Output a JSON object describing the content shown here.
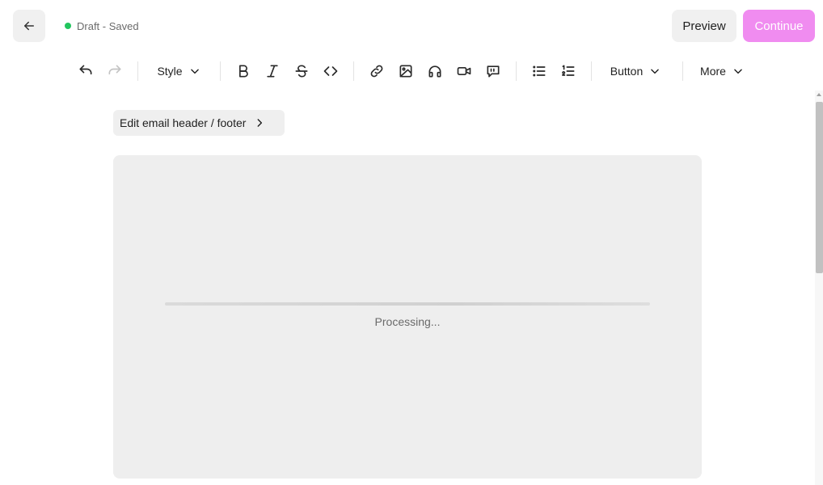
{
  "header": {
    "status_text": "Draft - Saved",
    "status_color": "#22c55e",
    "back_icon": "arrow-left-icon",
    "preview_label": "Preview",
    "continue_label": "Continue",
    "continue_color": "#f08cf0"
  },
  "toolbar": {
    "style_label": "Style",
    "button_label": "Button",
    "more_label": "More",
    "icons": [
      "undo-icon",
      "redo-icon",
      "chevron-down-icon",
      "bold-icon",
      "italic-icon",
      "strikethrough-icon",
      "code-icon",
      "link-icon",
      "image-icon",
      "headphones-icon",
      "video-icon",
      "quote-bubble-icon",
      "bullet-list-icon",
      "numbered-list-icon"
    ]
  },
  "editor": {
    "header_footer_label": "Edit email header / footer",
    "processing_text": "Processing...",
    "progress_percent": 100
  }
}
